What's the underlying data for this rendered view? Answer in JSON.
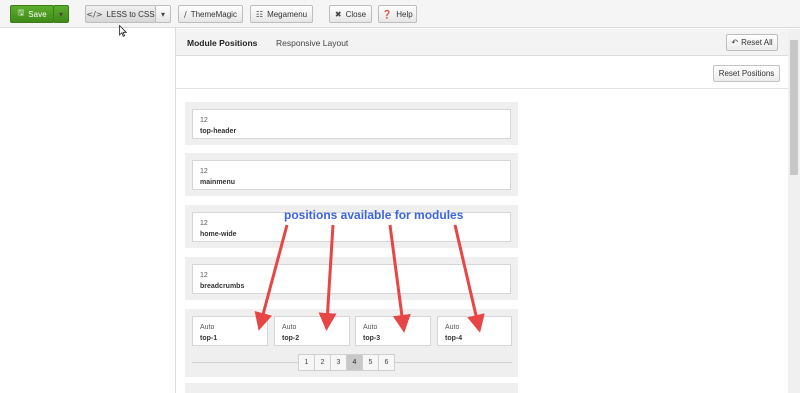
{
  "toolbar": {
    "save": "Save",
    "less_to_css": "LESS to CSS",
    "thememagic": "ThemeMagic",
    "megamenu": "Megamenu",
    "close": "Close",
    "help": "Help"
  },
  "tabs": {
    "module_positions": "Module Positions",
    "responsive_layout": "Responsive Layout",
    "reset_all": "Reset All"
  },
  "reset_positions": "Reset Positions",
  "rows": [
    {
      "width": "12",
      "name": "top-header"
    },
    {
      "width": "12",
      "name": "mainmenu"
    },
    {
      "width": "12",
      "name": "home-wide"
    },
    {
      "width": "12",
      "name": "breadcrumbs"
    }
  ],
  "multi_row": [
    {
      "width": "Auto",
      "name": "top-1"
    },
    {
      "width": "Auto",
      "name": "top-2"
    },
    {
      "width": "Auto",
      "name": "top-3"
    },
    {
      "width": "Auto",
      "name": "top-4"
    }
  ],
  "pager": [
    "1",
    "2",
    "3",
    "4",
    "5",
    "6"
  ],
  "pager_active": "4",
  "annotation": "positions available for modules",
  "colors": {
    "save_green": "#4a9a22",
    "annotation_blue": "#3a63e8",
    "arrow_red": "#e84545"
  }
}
